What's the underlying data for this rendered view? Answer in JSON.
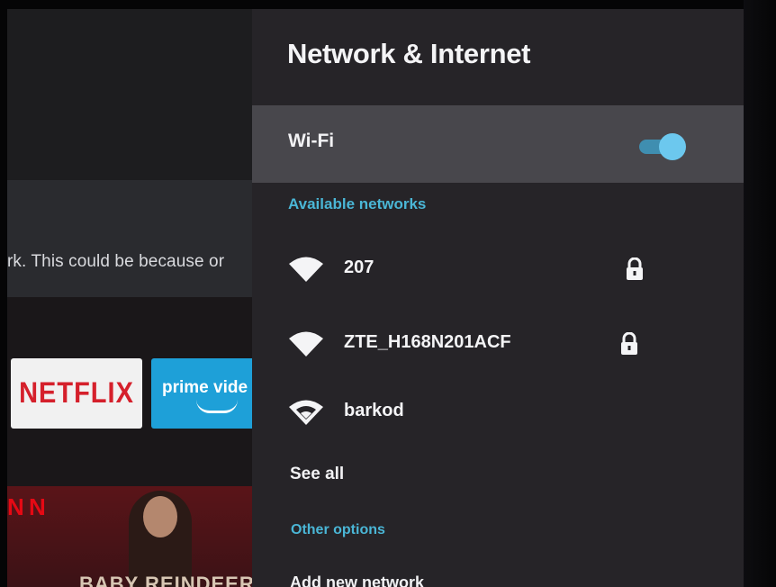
{
  "background": {
    "banner_text": "rk. This could be because or",
    "apps": [
      {
        "name": "NETFLIX",
        "color": "#d5202b"
      },
      {
        "name": "prime vide",
        "color": "#1ea0d8"
      }
    ],
    "poster_letter": "N",
    "poster_title": "BABY REINDEER"
  },
  "panel": {
    "title": "Network & Internet",
    "wifi": {
      "label": "Wi-Fi",
      "enabled": true,
      "accent": "#6cc8ee"
    },
    "available_header": "Available networks",
    "networks": [
      {
        "name": "207",
        "secured": true,
        "icon": "wifi-full-icon"
      },
      {
        "name": "ZTE_H168N201ACF",
        "secured": true,
        "icon": "wifi-full-icon"
      },
      {
        "name": "barkod",
        "secured": false,
        "icon": "wifi-outline-icon"
      }
    ],
    "see_all": "See all",
    "other_header": "Other options",
    "add_network": "Add new network"
  },
  "colors": {
    "section_header": "#4ab6d6",
    "panel_bg": "#262428",
    "selected_row": "#48474c"
  }
}
